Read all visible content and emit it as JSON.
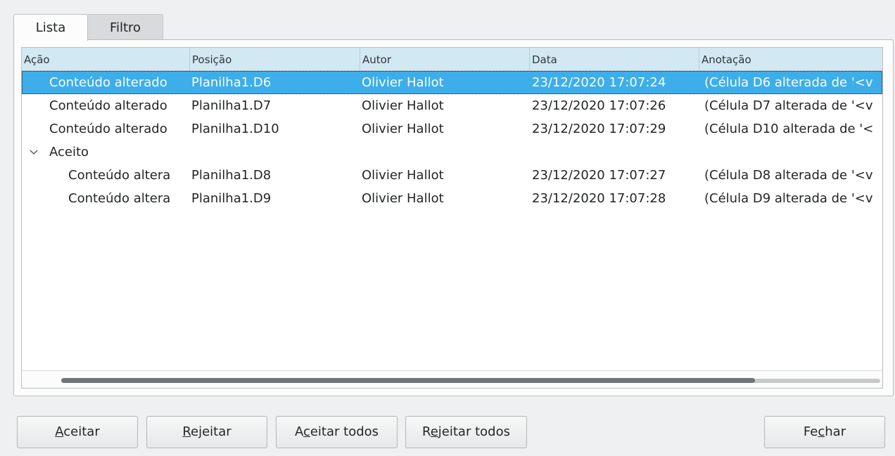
{
  "tabs": [
    {
      "label": "Lista",
      "active": true
    },
    {
      "label": "Filtro",
      "active": false
    }
  ],
  "columns": [
    "Ação",
    "Posição",
    "Autor",
    "Data",
    "Anotação"
  ],
  "rows": [
    {
      "action": "Conteúdo alterado",
      "position": "Planilha1.D6",
      "author": "Olivier Hallot",
      "date": "23/12/2020 17:07:24",
      "comment": "(Célula D6 alterada de '<v",
      "selected": true,
      "level": 0
    },
    {
      "action": "Conteúdo alterado",
      "position": "Planilha1.D7",
      "author": "Olivier Hallot",
      "date": "23/12/2020 17:07:26",
      "comment": "(Célula D7 alterada de '<v",
      "selected": false,
      "level": 0
    },
    {
      "action": "Conteúdo alterado",
      "position": "Planilha1.D10",
      "author": "Olivier Hallot",
      "date": "23/12/2020 17:07:29",
      "comment": "(Célula D10 alterada de '<",
      "selected": false,
      "level": 0
    },
    {
      "group_label": "Aceito",
      "expander": "⌄",
      "level": 0
    },
    {
      "action": "Conteúdo altera",
      "position": "Planilha1.D8",
      "author": "Olivier Hallot",
      "date": "23/12/2020 17:07:27",
      "comment": "(Célula D8 alterada de '<v",
      "selected": false,
      "level": 1
    },
    {
      "action": "Conteúdo altera",
      "position": "Planilha1.D9",
      "author": "Olivier Hallot",
      "date": "23/12/2020 17:07:28",
      "comment": "(Célula D9 alterada de '<v",
      "selected": false,
      "level": 1
    }
  ],
  "buttons": {
    "accept": {
      "mnemonic": "A",
      "rest": "ceitar"
    },
    "reject": {
      "mnemonic": "R",
      "rest": "ejeitar"
    },
    "accept_all": {
      "pre": "A",
      "mnemonic": "c",
      "rest": "eitar todos"
    },
    "reject_all": {
      "pre": "R",
      "mnemonic": "e",
      "rest": "jeitar todos"
    },
    "close": {
      "pre": "Fe",
      "mnemonic": "c",
      "rest": "har"
    }
  },
  "colors": {
    "selection": "#3daee9",
    "header_bg": "#d2e8f3",
    "window_bg": "#eff0f1"
  }
}
